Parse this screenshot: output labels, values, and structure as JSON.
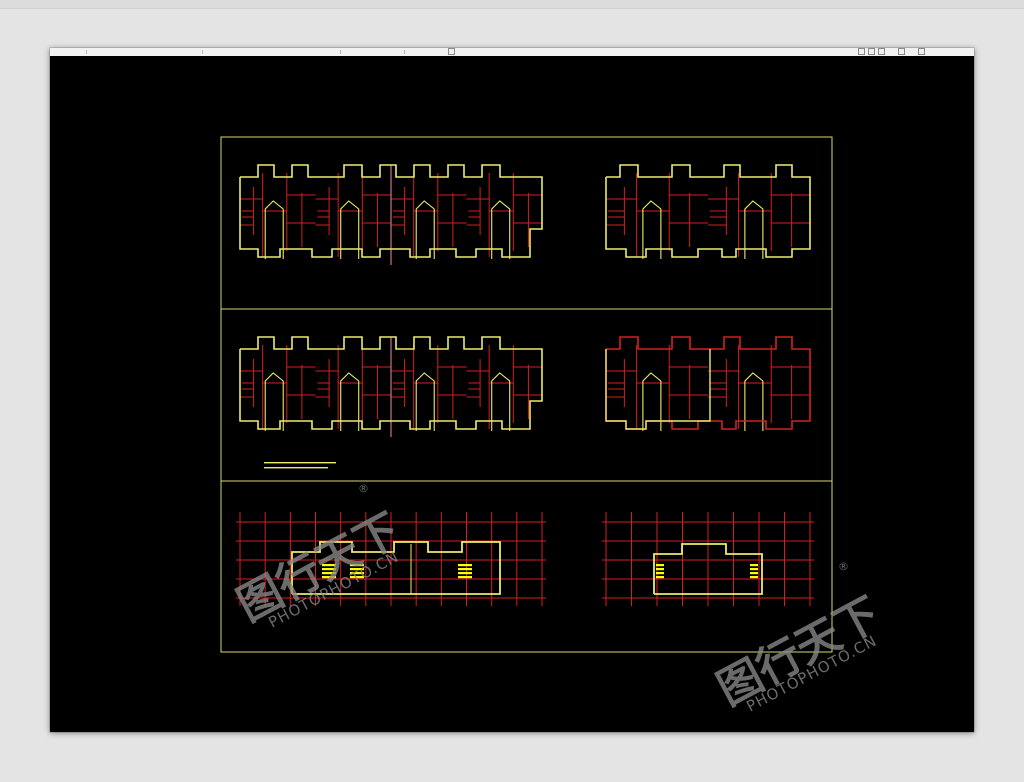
{
  "colors": {
    "desktop": "#e4e4e4",
    "canvas": "#000000",
    "sheet_border": "#d8d86a",
    "wall_red": "#d42020",
    "wall_yellow": "#ecec6a",
    "wall_pink": "#f08aa8",
    "stair_fill": "#ffff00",
    "watermark": "#8a8a8a"
  },
  "drawing": {
    "rows": [
      {
        "name": "plan-row-1",
        "blocks": [
          "four-unit-block",
          "two-unit-block"
        ]
      },
      {
        "name": "plan-row-2",
        "blocks": [
          "four-unit-block",
          "two-unit-block"
        ]
      },
      {
        "name": "plan-row-3",
        "blocks": [
          "four-unit-block",
          "two-unit-block"
        ]
      }
    ],
    "note_line_count": 2
  },
  "watermark": {
    "logo_glyphs": "图行天下",
    "url_text": "PHOTOPHOTO.CN",
    "registered_mark": "®"
  }
}
